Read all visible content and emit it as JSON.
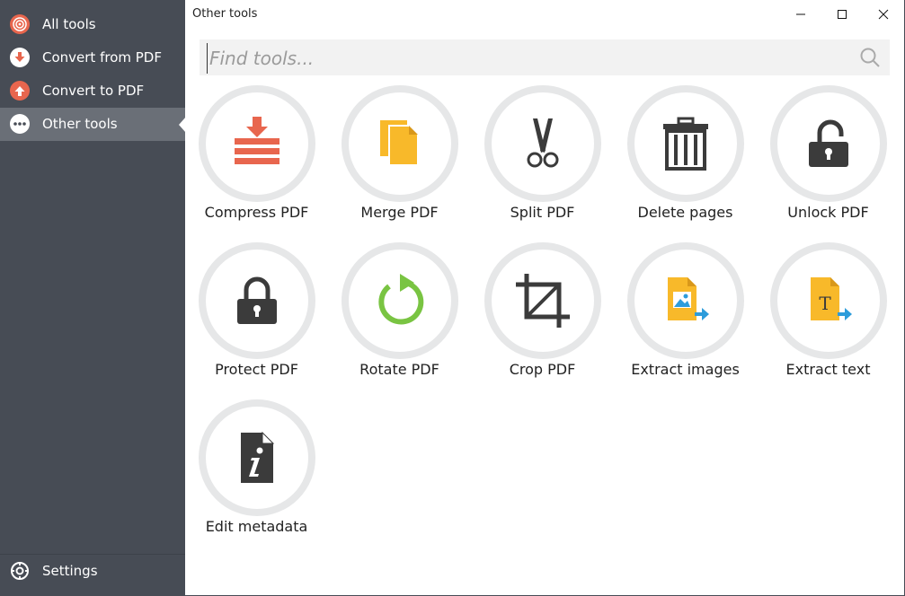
{
  "window": {
    "title": "Other tools"
  },
  "sidebar": {
    "items": [
      {
        "label": "All tools",
        "icon": "all-tools-icon",
        "active": false
      },
      {
        "label": "Convert from PDF",
        "icon": "arrow-down-icon",
        "active": false
      },
      {
        "label": "Convert to PDF",
        "icon": "arrow-up-icon",
        "active": false
      },
      {
        "label": "Other tools",
        "icon": "more-dots-icon",
        "active": true
      }
    ],
    "settings": {
      "label": "Settings",
      "icon": "gear-icon"
    }
  },
  "search": {
    "placeholder": "Find tools...",
    "value": ""
  },
  "tools": [
    {
      "label": "Compress PDF",
      "icon": "compress-icon"
    },
    {
      "label": "Merge PDF",
      "icon": "merge-icon"
    },
    {
      "label": "Split PDF",
      "icon": "scissors-icon"
    },
    {
      "label": "Delete pages",
      "icon": "trash-icon"
    },
    {
      "label": "Unlock PDF",
      "icon": "unlock-icon"
    },
    {
      "label": "Protect PDF",
      "icon": "lock-icon"
    },
    {
      "label": "Rotate PDF",
      "icon": "rotate-icon"
    },
    {
      "label": "Crop PDF",
      "icon": "crop-icon"
    },
    {
      "label": "Extract images",
      "icon": "extract-images-icon"
    },
    {
      "label": "Extract text",
      "icon": "extract-text-icon"
    },
    {
      "label": "Edit metadata",
      "icon": "metadata-icon"
    }
  ],
  "colors": {
    "sidebar_bg": "#474c55",
    "active_item": "#6a6f77",
    "accent_red": "#e8664e",
    "folder_yellow": "#f8b92a",
    "rotate_green": "#79c442",
    "dark_icon": "#3b3b3b",
    "blue_arrow": "#2d9cdb"
  }
}
